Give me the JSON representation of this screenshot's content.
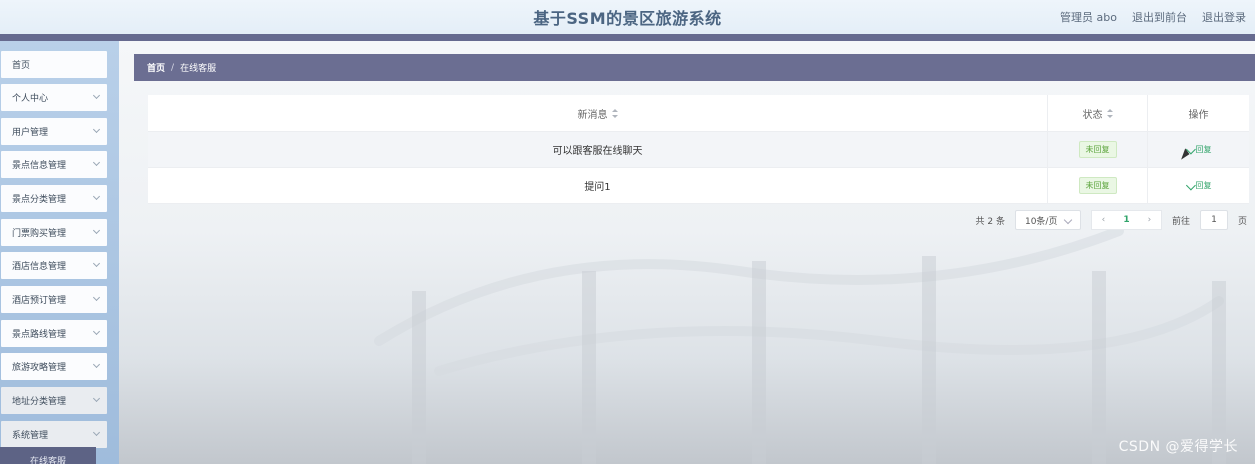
{
  "header": {
    "title": "基于SSM的景区旅游系统",
    "user": "管理员 abo",
    "to_front": "退出到前台",
    "logout": "退出登录"
  },
  "sidebar": {
    "items": [
      {
        "label": "首页",
        "has_arrow": false
      },
      {
        "label": "个人中心",
        "has_arrow": true
      },
      {
        "label": "用户管理",
        "has_arrow": true
      },
      {
        "label": "景点信息管理",
        "has_arrow": true
      },
      {
        "label": "景点分类管理",
        "has_arrow": true
      },
      {
        "label": "门票购买管理",
        "has_arrow": true
      },
      {
        "label": "酒店信息管理",
        "has_arrow": true
      },
      {
        "label": "酒店预订管理",
        "has_arrow": true
      },
      {
        "label": "景点路线管理",
        "has_arrow": true
      },
      {
        "label": "旅游攻略管理",
        "has_arrow": true
      },
      {
        "label": "地址分类管理",
        "has_arrow": true
      },
      {
        "label": "系统管理",
        "has_arrow": true
      }
    ],
    "active_submenu": "在线客服"
  },
  "breadcrumb": {
    "home": "首页",
    "separator": "/",
    "current": "在线客服"
  },
  "table": {
    "headers": {
      "message": "新消息",
      "status": "状态",
      "action": "操作"
    },
    "rows": [
      {
        "message": "可以跟客服在线聊天",
        "status": "未回复",
        "action": "回复"
      },
      {
        "message": "提问1",
        "status": "未回复",
        "action": "回复"
      }
    ]
  },
  "pagination": {
    "total": "共 2 条",
    "page_size": "10条/页",
    "current_page": "1",
    "goto_label": "前往",
    "goto_value": "1",
    "page_unit": "页"
  },
  "watermark": "CSDN @爱得学长",
  "colors": {
    "header_bar": "#666a8f",
    "breadcrumb_bg": "#6b6e92",
    "sidebar_bg": "#b9d0e9",
    "status_tag": "#5aa33a",
    "action_link": "#31a46a"
  }
}
